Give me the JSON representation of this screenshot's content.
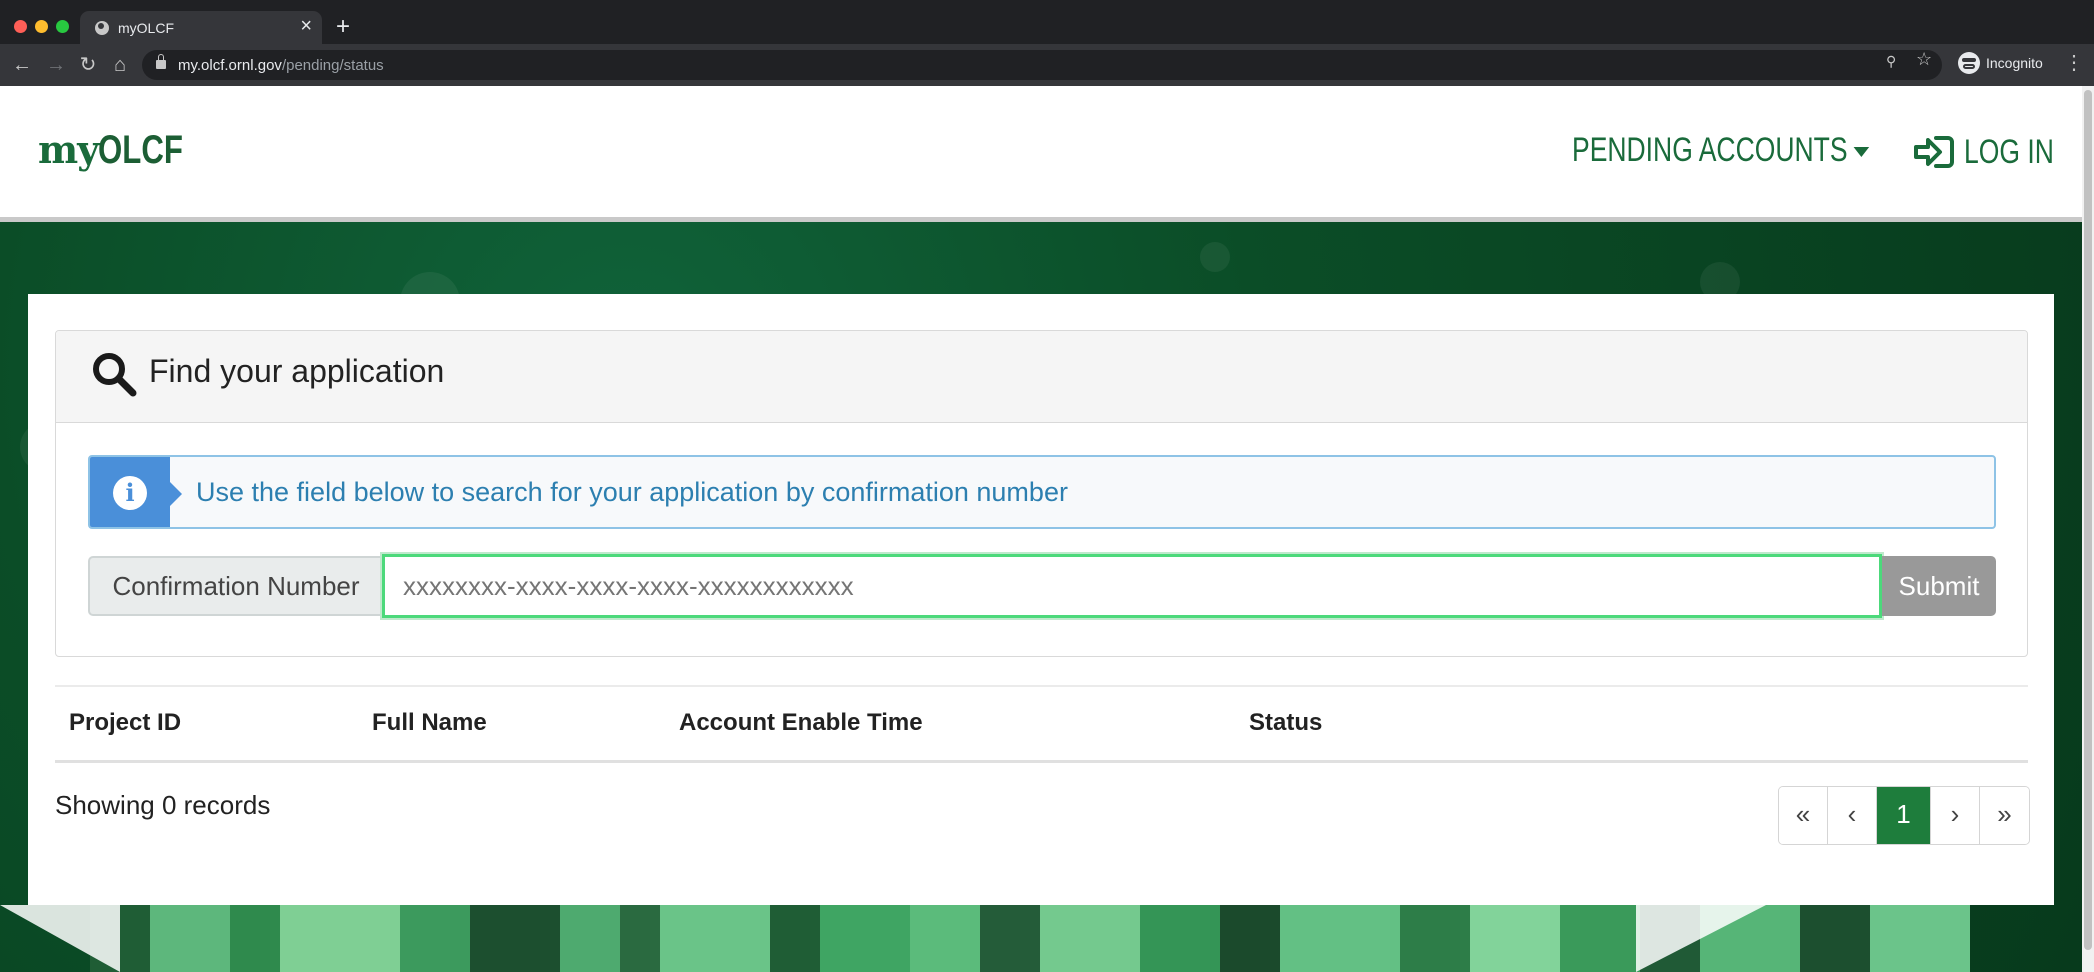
{
  "browser": {
    "tab_title": "myOLCF",
    "url_host": "my.olcf.ornl.gov",
    "url_path": "/pending/status",
    "profile_label": "Incognito"
  },
  "site": {
    "logo_prefix": "my",
    "logo_suffix": "OLCF",
    "nav_pending": "PENDING ACCOUNTS",
    "nav_login": "LOG IN"
  },
  "panel": {
    "title": "Find your application",
    "alert_text": "Use the field below to search for your application by confirmation number",
    "input_label": "Confirmation Number",
    "input_placeholder": "xxxxxxxx-xxxx-xxxx-xxxx-xxxxxxxxxxxx",
    "submit_label": "Submit"
  },
  "table": {
    "columns": [
      "Project ID",
      "Full Name",
      "Account Enable Time",
      "Status"
    ],
    "rows": []
  },
  "footer": {
    "showing_text": "Showing 0 records"
  },
  "pagination": {
    "first": "«",
    "prev": "‹",
    "current": "1",
    "next": "›",
    "last": "»"
  },
  "colors": {
    "brand_green": "#1a6b3b",
    "active_page": "#1e7d3c",
    "alert_blue": "#4a8fd9",
    "input_focus": "#4cd97b"
  }
}
